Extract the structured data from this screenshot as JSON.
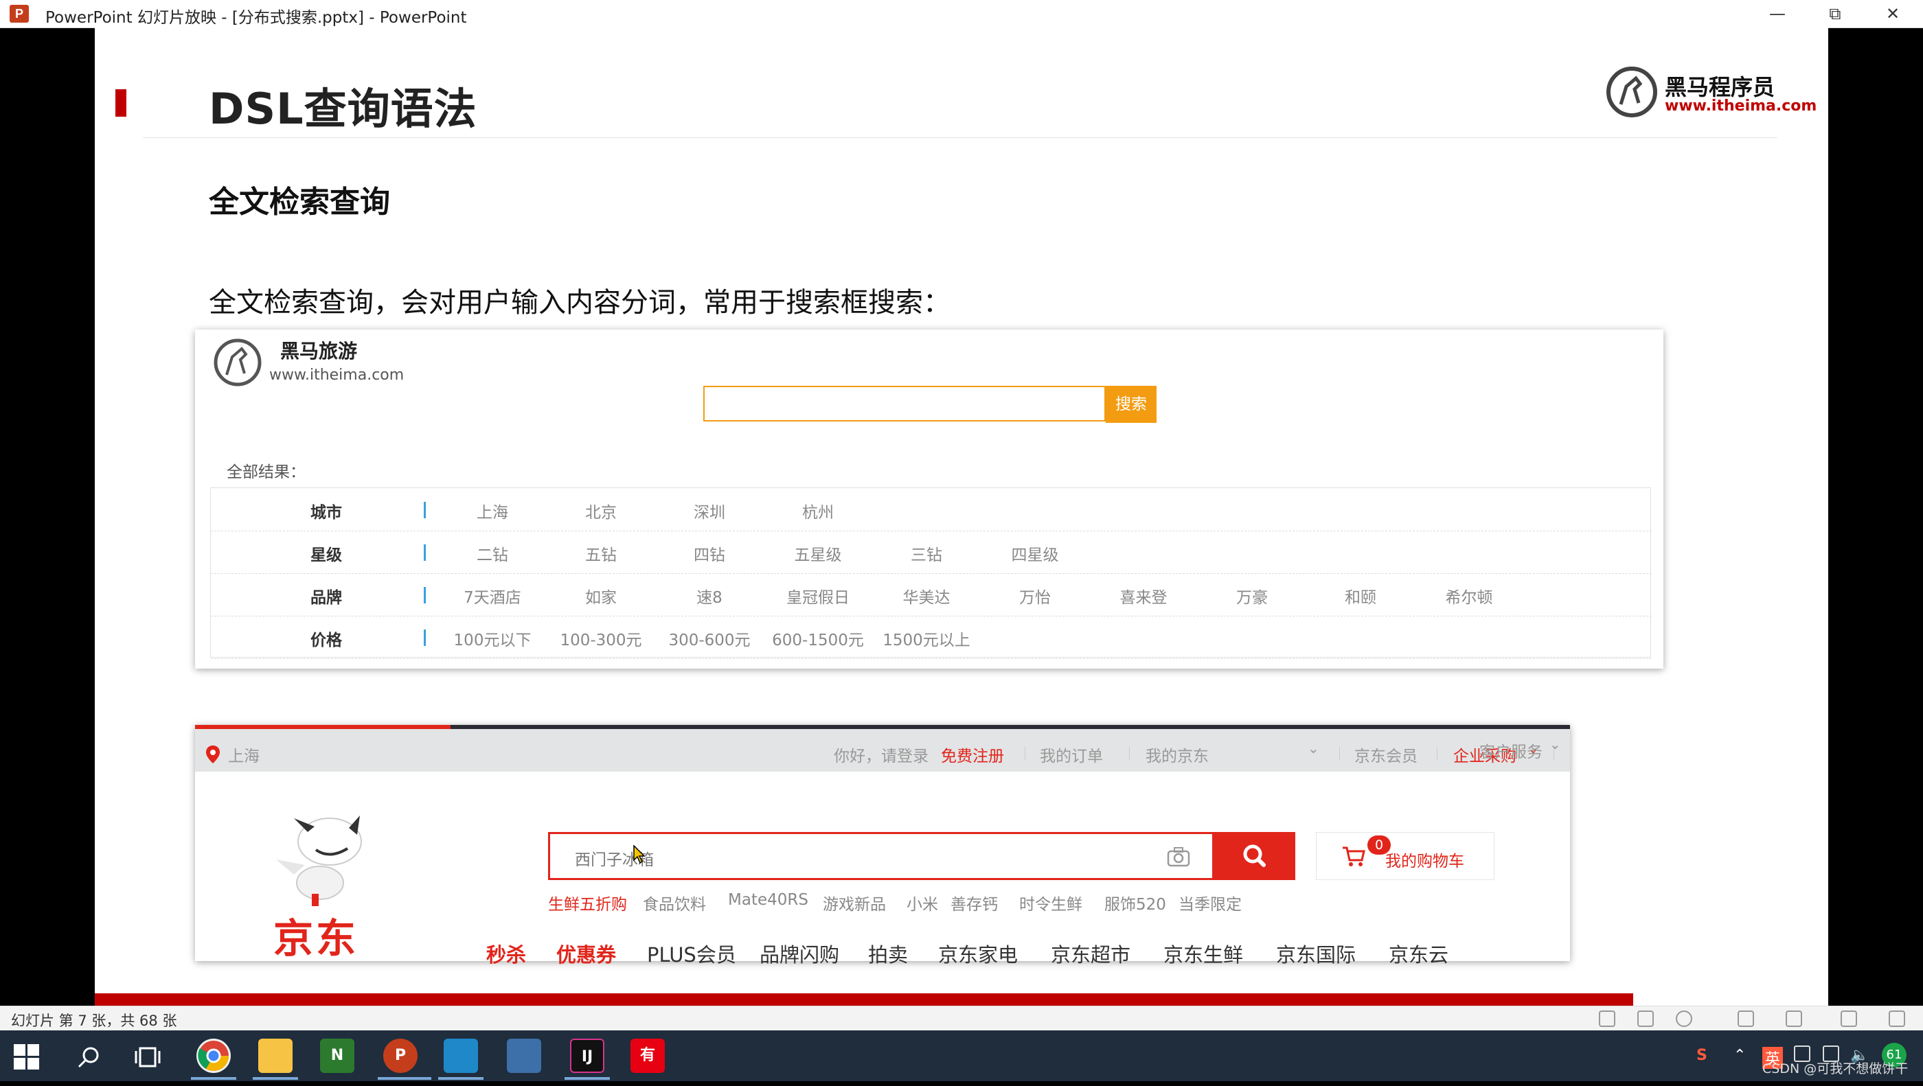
{
  "window": {
    "title": "PowerPoint 幻灯片放映 - [分布式搜索.pptx] - PowerPoint",
    "app_icon": "P",
    "controls": [
      "minimize-icon",
      "restore-icon",
      "close-icon"
    ]
  },
  "slide": {
    "title": "DSL查询语法",
    "brand": {
      "name": "黑马程序员",
      "url": "www.itheima.com"
    },
    "subtitle": "全文检索查询",
    "body": "全文检索查询，会对用户输入内容分词，常用于搜索框搜索："
  },
  "travel_site": {
    "name": "黑马旅游",
    "url": "www.itheima.com",
    "search_placeholder": "",
    "search_button": "搜索",
    "all_results_label": "全部结果：",
    "filters": [
      {
        "label": "城市",
        "options": [
          "上海",
          "北京",
          "深圳",
          "杭州"
        ]
      },
      {
        "label": "星级",
        "options": [
          "二钻",
          "五钻",
          "四钻",
          "五星级",
          "三钻",
          "四星级"
        ]
      },
      {
        "label": "品牌",
        "options": [
          "7天酒店",
          "如家",
          "速8",
          "皇冠假日",
          "华美达",
          "万怡",
          "喜来登",
          "万豪",
          "和颐",
          "希尔顿"
        ]
      },
      {
        "label": "价格",
        "options": [
          "100元以下",
          "100-300元",
          "300-600元",
          "600-1500元",
          "1500元以上"
        ]
      }
    ]
  },
  "jd_site": {
    "location": "上海",
    "greeting": "你好，请登录",
    "register": "免费注册",
    "nav": [
      "我的订单",
      "我的京东",
      "京东会员",
      "企业采购",
      "客户服务"
    ],
    "logo_text": "京东",
    "search_value": "西门子冰箱",
    "cart_count": "0",
    "cart_label": "我的购物车",
    "hot_words": [
      "生鲜五折购",
      "食品饮料",
      "Mate40RS",
      "游戏新品",
      "小米",
      "善存钙",
      "时令生鲜",
      "服饰520",
      "当季限定"
    ],
    "menu": [
      "秒杀",
      "优惠券",
      "PLUS会员",
      "品牌闪购",
      "拍卖",
      "京东家电",
      "京东超市",
      "京东生鲜",
      "京东国际",
      "京东云"
    ]
  },
  "status_bar": {
    "slide_info": "幻灯片 第 7 张，共 68 张"
  },
  "taskbar": {
    "apps": [
      "chrome-icon",
      "file-explorer-icon",
      "onenote-icon",
      "powerpoint-icon",
      "remote-desktop-icon",
      "window-icon",
      "intellij-icon",
      "youdao-icon"
    ],
    "tray_ime": "英",
    "tray_s": "S",
    "badge": "61",
    "watermark": "CSDN @可我不想做饼干"
  }
}
